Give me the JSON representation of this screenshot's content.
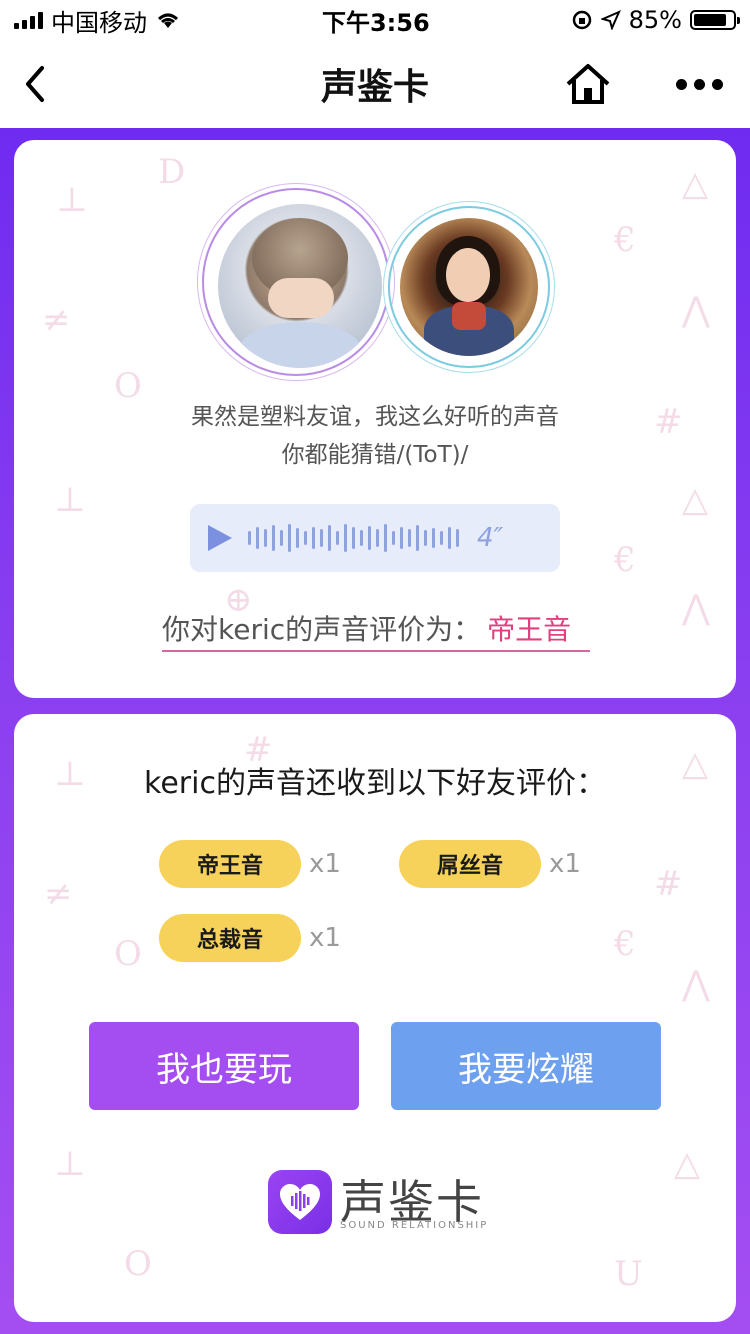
{
  "status_bar": {
    "carrier": "中国移动",
    "time": "下午3:56",
    "battery": "85%",
    "battery_level": 0.85
  },
  "nav": {
    "title": "声鉴卡"
  },
  "colors": {
    "accent_purple": "#a44ef2",
    "accent_blue": "#6ea0f0",
    "tag_yellow": "#f7d25a",
    "result_pink": "#e0407f"
  },
  "message": {
    "line1": "果然是塑料友谊，我这么好听的声音",
    "line2": "你都能猜错/(ToT)/"
  },
  "voice": {
    "duration": "4″"
  },
  "evaluation": {
    "prefix": "你对keric的声音评价为：",
    "result": "帝王音"
  },
  "friends": {
    "title": "keric的声音还收到以下好友评价：",
    "tags": [
      {
        "label": "帝王音",
        "count": "x1"
      },
      {
        "label": "屌丝音",
        "count": "x1"
      },
      {
        "label": "总裁音",
        "count": "x1"
      }
    ]
  },
  "buttons": {
    "play": "我也要玩",
    "show": "我要炫耀"
  },
  "logo": {
    "name": "声鉴卡",
    "subtitle": "SOUND RELATIONSHIP"
  }
}
